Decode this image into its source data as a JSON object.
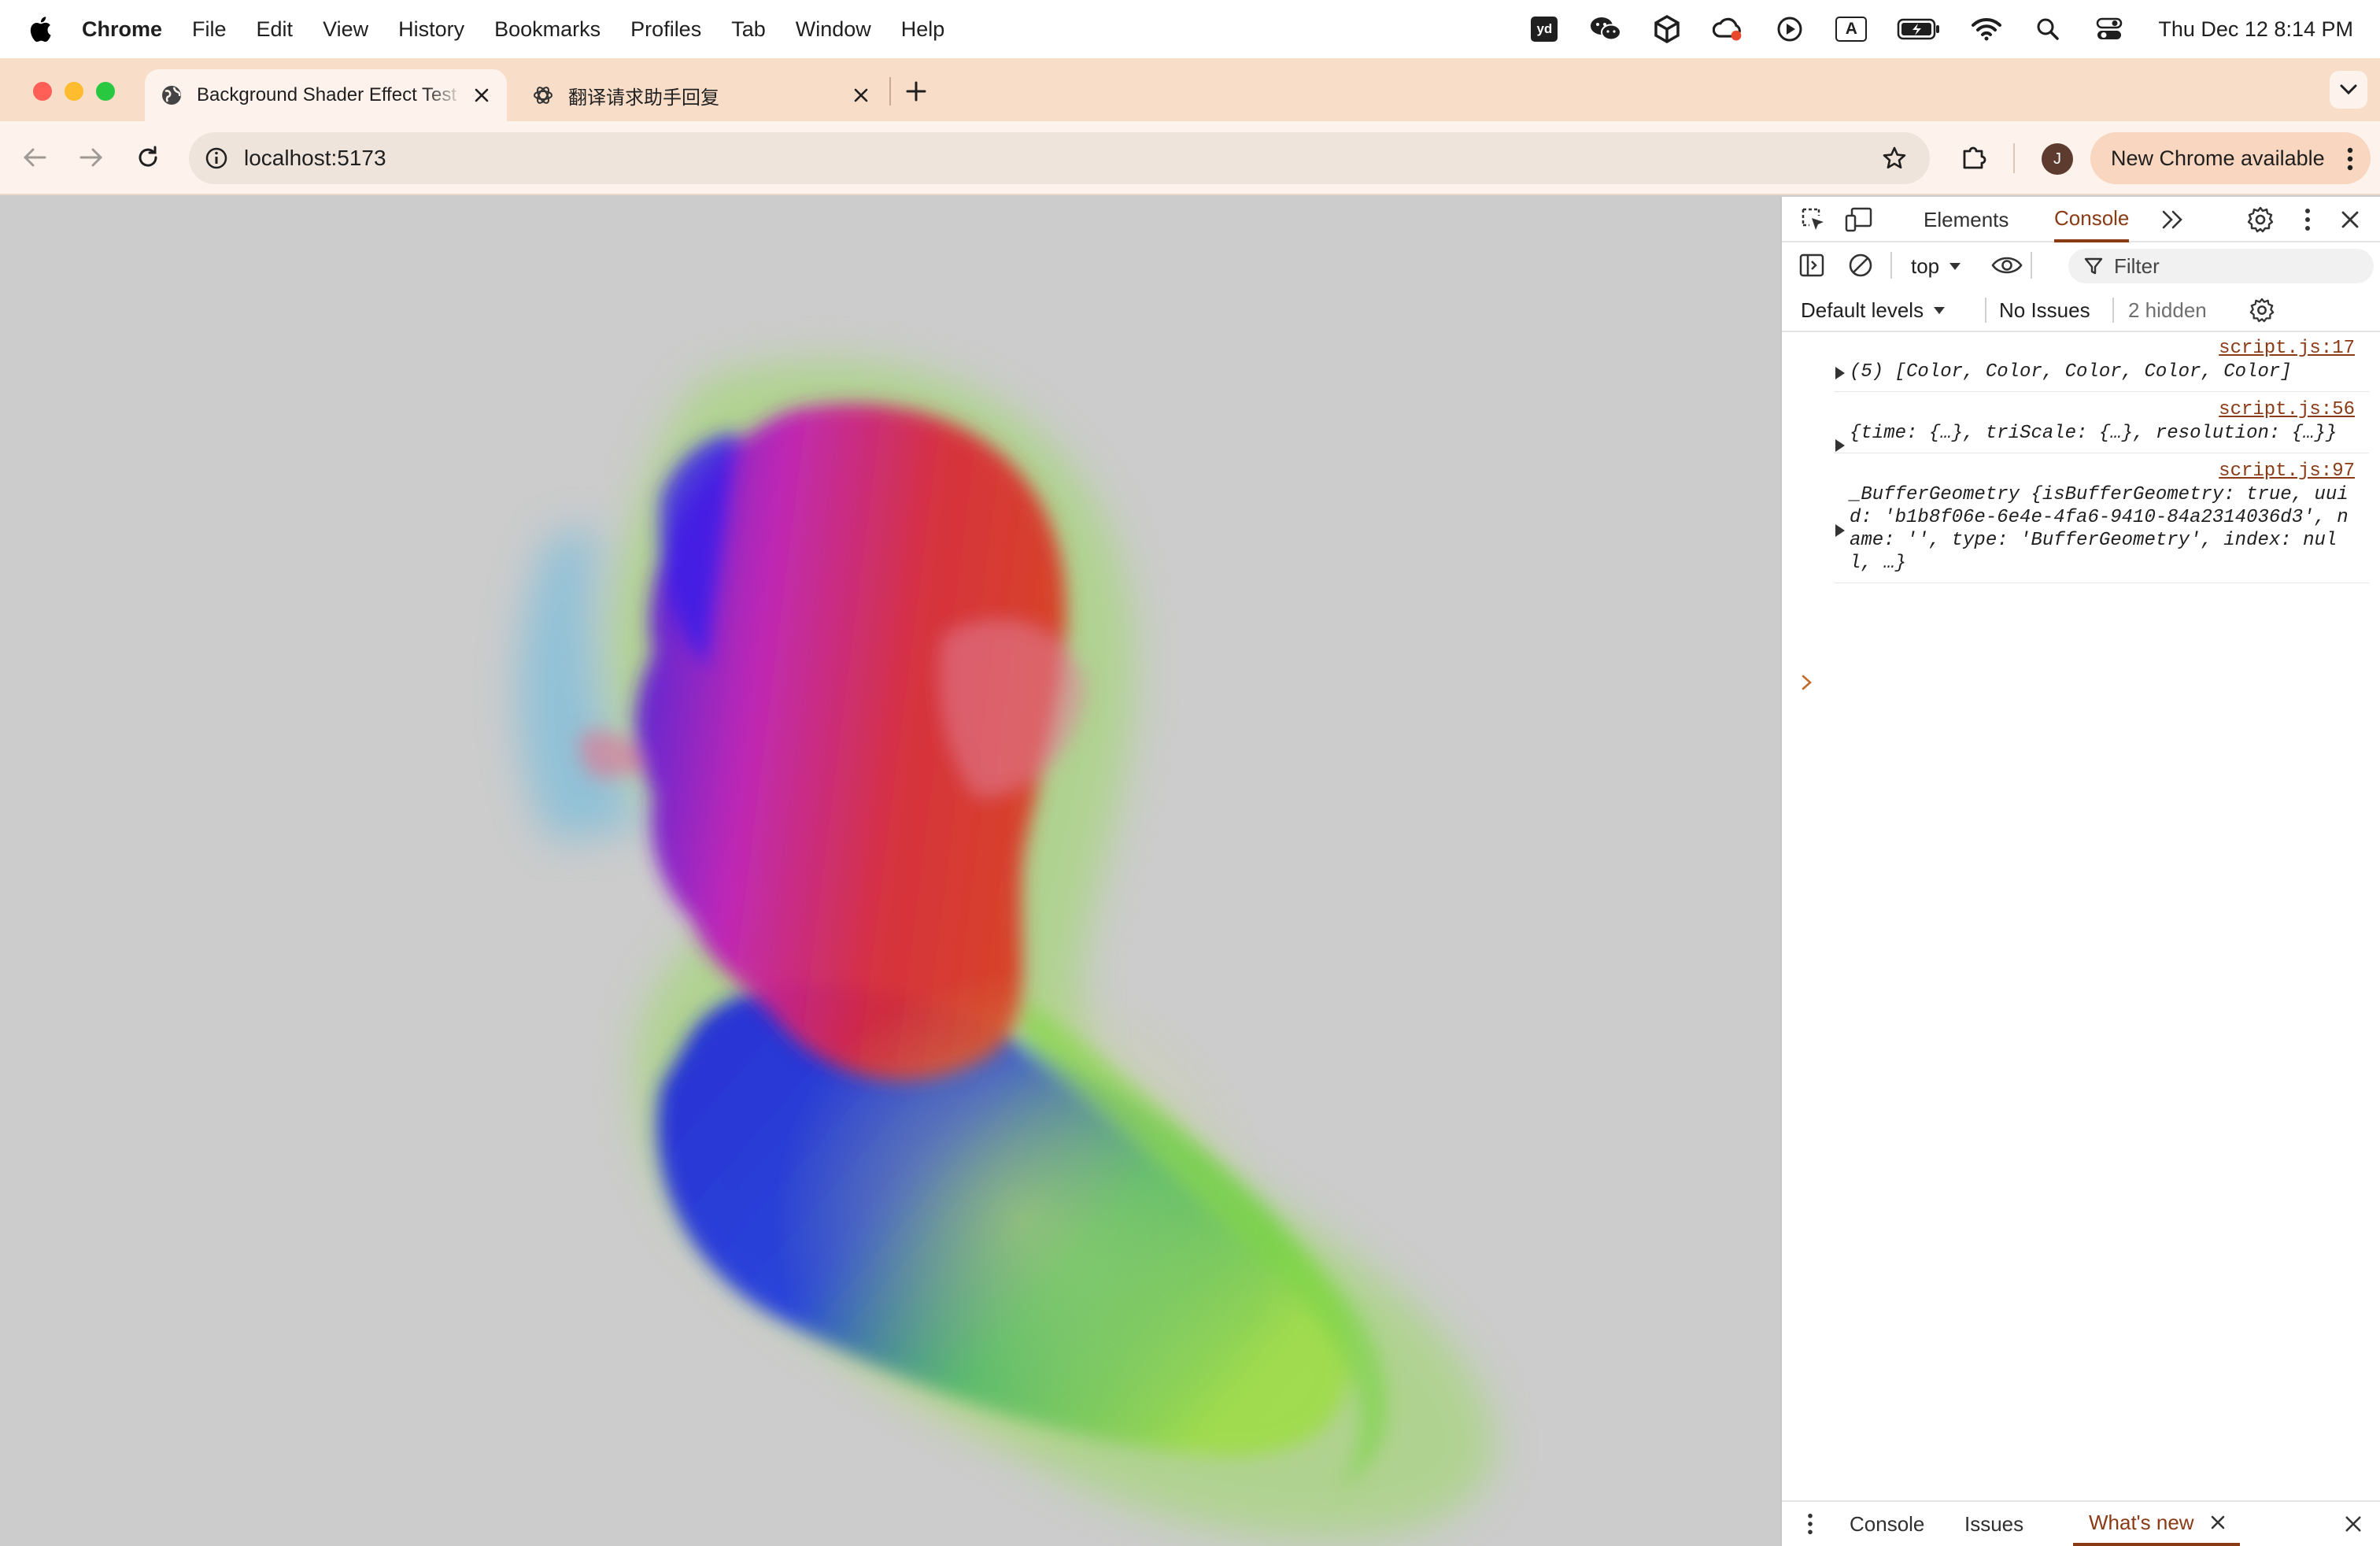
{
  "menubar": {
    "app_name": "Chrome",
    "items": [
      "File",
      "Edit",
      "View",
      "History",
      "Bookmarks",
      "Profiles",
      "Tab",
      "Window",
      "Help"
    ],
    "status_icons": [
      "youdao-icon",
      "wechat-icon",
      "unity-icon",
      "creative-cloud-icon",
      "play-icon",
      "input-source-icon",
      "battery-icon",
      "wifi-icon",
      "spotlight-search-icon",
      "control-center-icon"
    ],
    "input_source_label": "A",
    "youdao_label": "yd",
    "clock": "Thu Dec 12  8:14 PM"
  },
  "tabs": [
    {
      "title": "Background Shader Effect Test",
      "active": true
    },
    {
      "title": "翻译请求助手回复",
      "active": false
    }
  ],
  "toolbar": {
    "url": "localhost:5173",
    "avatar_initial": "J",
    "new_chrome_label": "New Chrome available"
  },
  "devtools": {
    "tabs": [
      "Elements",
      "Console"
    ],
    "selected_tab": "Console",
    "context": "top",
    "filter_placeholder": "Filter",
    "levels": "Default levels",
    "issues": "No Issues",
    "hidden": "2 hidden",
    "messages": [
      {
        "source": "script.js:17",
        "text": "(5) [Color, Color, Color, Color, Color]"
      },
      {
        "source": "script.js:56",
        "text": "{time: {…}, triScale: {…}, resolution: {…}}"
      },
      {
        "source": "script.js:97",
        "text": "_BufferGeometry {isBufferGeometry: true, uuid: 'b1b8f06e-6e4e-4fa6-9410-84a2314036d3', name: '', type: 'BufferGeometry', index: null, …}"
      }
    ],
    "drawer_tabs": [
      "Console",
      "Issues",
      "What's new"
    ],
    "drawer_selected": "What's new"
  },
  "colors": {
    "tabstrip": "#f8ddc9",
    "toolbar": "#fdf3ec",
    "accent": "#8a3a14",
    "viewport_bg": "#cccccc"
  }
}
